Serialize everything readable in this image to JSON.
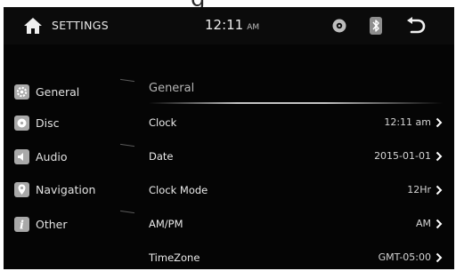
{
  "header": {
    "title": "SETTINGS",
    "time": "12:11",
    "ampm": "AM"
  },
  "sidebar": {
    "items": [
      {
        "label": "General",
        "icon": "gear-icon"
      },
      {
        "label": "Disc",
        "icon": "disc-icon"
      },
      {
        "label": "Audio",
        "icon": "speaker-icon"
      },
      {
        "label": "Navigation",
        "icon": "map-pin-icon"
      },
      {
        "label": "Other",
        "icon": "info-icon"
      }
    ]
  },
  "main": {
    "title": "General",
    "settings": [
      {
        "label": "Clock",
        "value": "12:11 am"
      },
      {
        "label": "Date",
        "value": "2015-01-01"
      },
      {
        "label": "Clock Mode",
        "value": "12Hr"
      },
      {
        "label": "AM/PM",
        "value": "AM"
      },
      {
        "label": "TimeZone",
        "value": "GMT-05:00"
      }
    ]
  },
  "colors": {
    "background": "#050505",
    "icon_tile": "#a9a9a9",
    "text": "#e2e2e2",
    "muted_text": "#b5b5b5"
  }
}
